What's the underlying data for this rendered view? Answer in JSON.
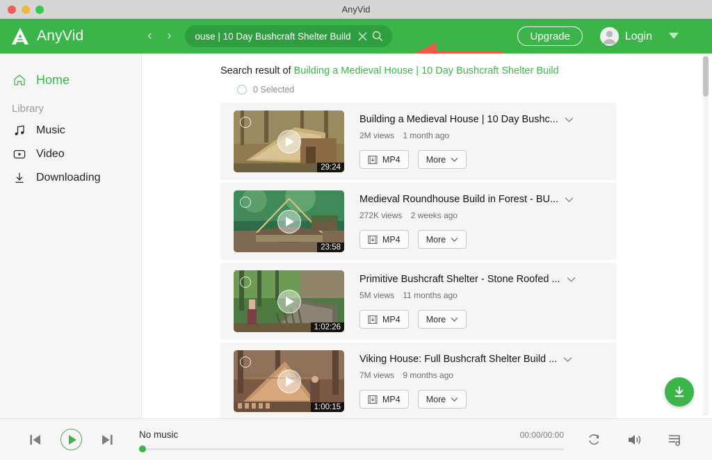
{
  "window": {
    "title": "AnyVid"
  },
  "titlebar": {
    "buttons": [
      {
        "name": "close",
        "color": "#ef5f56"
      },
      {
        "name": "minimize",
        "color": "#f0b83a"
      },
      {
        "name": "maximize",
        "color": "#3bc94a"
      }
    ]
  },
  "header": {
    "brand": "AnyVid",
    "logo_icon": "anyvid-logo-icon",
    "back_icon": "‹",
    "forward_icon": "›",
    "search": {
      "value": "ouse | 10 Day Bushcraft Shelter Build",
      "full_value": "Building a Medieval House | 10 Day Bushcraft Shelter Build",
      "clear_icon": "close-icon",
      "submit_icon": "search-icon"
    },
    "upgrade_label": "Upgrade",
    "login_label": "Login",
    "avatar_icon": "user-avatar-icon",
    "dropdown_icon": "chevron-down-icon",
    "accent_color": "#3bb54a",
    "search_bg": "#2f9e3e",
    "annotation_arrow_color": "#f4564a"
  },
  "sidebar": {
    "items": [
      {
        "label": "Home",
        "icon": "home-icon",
        "active": true
      },
      {
        "label": "Music",
        "icon": "music-note-icon",
        "active": false
      },
      {
        "label": "Video",
        "icon": "video-play-icon",
        "active": false
      },
      {
        "label": "Downloading",
        "icon": "download-arrow-icon",
        "active": false
      }
    ],
    "section_heading": "Library"
  },
  "main": {
    "result_prefix": "Search result of",
    "result_query": "Building a Medieval House | 10 Day Bushcraft Shelter Build",
    "selected_label": "0 Selected",
    "download_fab_icon": "download-circle-icon",
    "results": [
      {
        "title": "Building a Medieval House | 10 Day Bushc...",
        "views": "2M views",
        "age": "1 month ago",
        "duration": "29:24",
        "format_label": "MP4",
        "more_label": "More",
        "thumb_palette": [
          "#8e7a4e",
          "#c4ab74",
          "#5b4e32"
        ]
      },
      {
        "title": "Medieval Roundhouse Build in Forest - BU...",
        "views": "272K views",
        "age": "2 weeks ago",
        "duration": "23:58",
        "format_label": "MP4",
        "more_label": "More",
        "thumb_palette": [
          "#2f6b4a",
          "#7fae6a",
          "#1d3f2b"
        ]
      },
      {
        "title": "Primitive Bushcraft Shelter - Stone Roofed ...",
        "views": "5M views",
        "age": "11 months ago",
        "duration": "1:02:26",
        "format_label": "MP4",
        "more_label": "More",
        "thumb_palette": [
          "#4d7a41",
          "#9bb77a",
          "#6d6a55"
        ]
      },
      {
        "title": "Viking House: Full Bushcraft Shelter Build ...",
        "views": "7M views",
        "age": "9 months ago",
        "duration": "1:00:15",
        "format_label": "MP4",
        "more_label": "More",
        "thumb_palette": [
          "#7a5a44",
          "#c49a72",
          "#3d2f26"
        ]
      }
    ]
  },
  "player": {
    "track_title": "No music",
    "time": "00:00/00:00",
    "prev_icon": "skip-previous-icon",
    "play_icon": "play-icon",
    "next_icon": "skip-next-icon",
    "repeat_icon": "repeat-icon",
    "volume_icon": "volume-icon",
    "playlist_icon": "playlist-icon",
    "progress_percent": 0
  }
}
